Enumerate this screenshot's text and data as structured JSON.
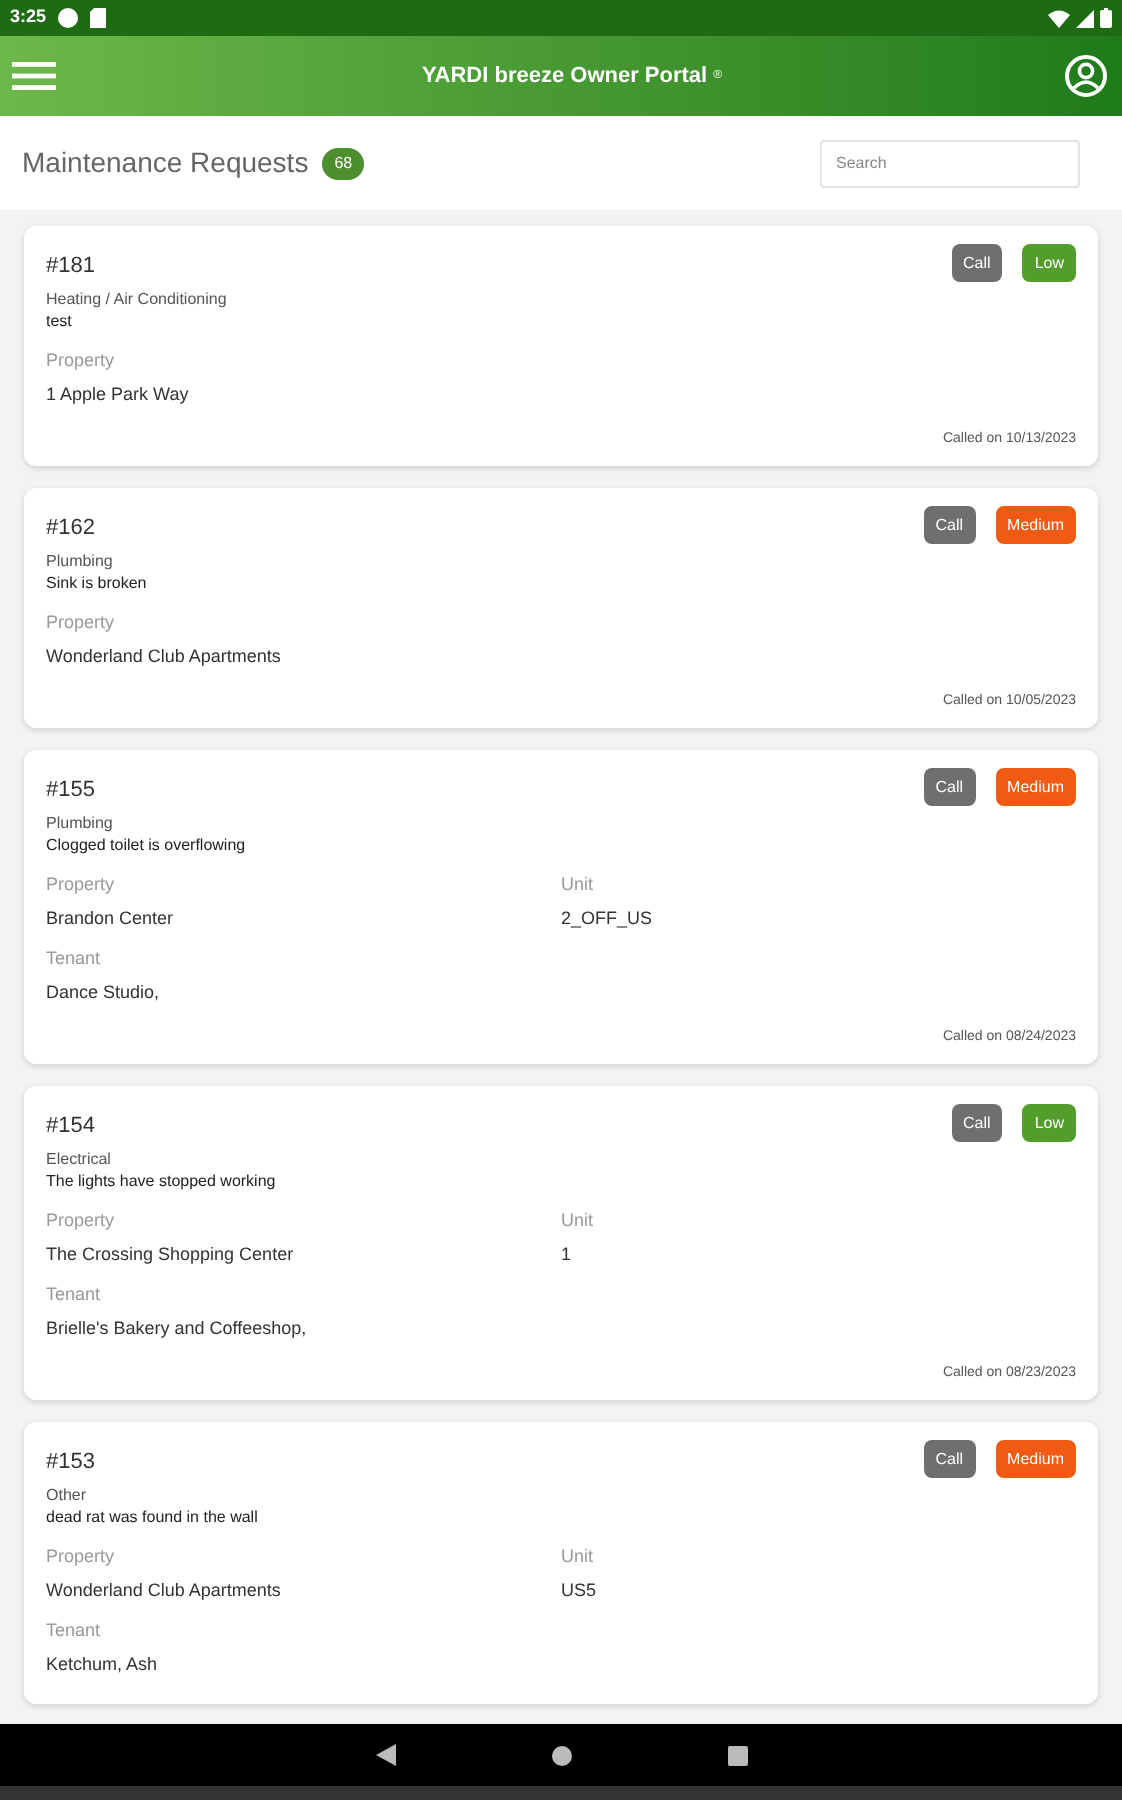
{
  "status_bar": {
    "time": "3:25"
  },
  "header": {
    "title": "YARDI breeze Owner Portal",
    "mark": "®"
  },
  "page": {
    "title": "Maintenance Requests",
    "count": "68",
    "search": {
      "placeholder": "Search"
    }
  },
  "requests": [
    {
      "id": "#181",
      "call": "Call",
      "priority": {
        "label": "Low",
        "color": "#539d2c"
      },
      "category": "Heating / Air Conditioning",
      "description": "test",
      "fields": [
        {
          "label": "Property",
          "value": "1 Apple Park Way"
        }
      ],
      "called": "Called on 10/13/2023"
    },
    {
      "id": "#162",
      "call": "Call",
      "priority": {
        "label": "Medium",
        "color": "#f05a12"
      },
      "category": "Plumbing",
      "description": "Sink is broken",
      "fields": [
        {
          "label": "Property",
          "value": "Wonderland Club Apartments"
        }
      ],
      "called": "Called on 10/05/2023"
    },
    {
      "id": "#155",
      "call": "Call",
      "priority": {
        "label": "Medium",
        "color": "#f05a12"
      },
      "category": "Plumbing",
      "description": "Clogged toilet is overflowing",
      "fields": [
        {
          "label": "Property",
          "value": "Brandon Center"
        },
        {
          "label": "Unit",
          "value": "2_OFF_US"
        },
        {
          "label": "Tenant",
          "value": "Dance Studio,"
        }
      ],
      "called": "Called on 08/24/2023"
    },
    {
      "id": "#154",
      "call": "Call",
      "priority": {
        "label": "Low",
        "color": "#539d2c"
      },
      "category": "Electrical",
      "description": "The lights have stopped working",
      "fields": [
        {
          "label": "Property",
          "value": "The Crossing Shopping Center"
        },
        {
          "label": "Unit",
          "value": "1"
        },
        {
          "label": "Tenant",
          "value": "Brielle's Bakery and Coffeeshop,"
        }
      ],
      "called": "Called on 08/23/2023"
    },
    {
      "id": "#153",
      "call": "Call",
      "priority": {
        "label": "Medium",
        "color": "#f05a12"
      },
      "category": "Other",
      "description": "dead rat was found in the wall",
      "fields": [
        {
          "label": "Property",
          "value": "Wonderland Club Apartments"
        },
        {
          "label": "Unit",
          "value": "US5"
        },
        {
          "label": "Tenant",
          "value": "Ketchum, Ash"
        }
      ]
    }
  ]
}
